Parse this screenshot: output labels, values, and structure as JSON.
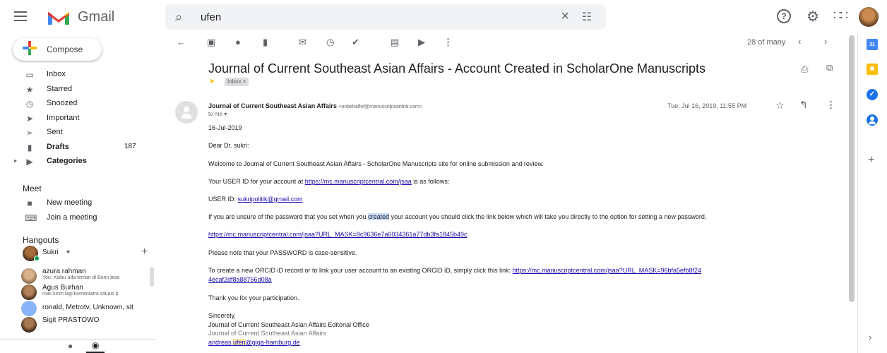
{
  "app": {
    "brand": "Gmail"
  },
  "search": {
    "query": "ufen"
  },
  "compose": {
    "label": "Compose"
  },
  "nav": {
    "items": [
      {
        "label": "Inbox",
        "icon": "inbox-icon",
        "glyph": "▭",
        "bold": false,
        "count": ""
      },
      {
        "label": "Starred",
        "icon": "star-icon",
        "glyph": "★",
        "bold": false,
        "count": ""
      },
      {
        "label": "Snoozed",
        "icon": "clock-icon",
        "glyph": "◷",
        "bold": false,
        "count": ""
      },
      {
        "label": "Important",
        "icon": "important-icon",
        "glyph": "➤",
        "bold": false,
        "count": ""
      },
      {
        "label": "Sent",
        "icon": "send-icon",
        "glyph": "➢",
        "bold": false,
        "count": ""
      },
      {
        "label": "Drafts",
        "icon": "draft-icon",
        "glyph": "▮",
        "bold": true,
        "count": "187"
      },
      {
        "label": "Categories",
        "icon": "label-icon",
        "glyph": "▶",
        "bold": true,
        "count": ""
      }
    ]
  },
  "meet": {
    "title": "Meet",
    "new_meeting": "New meeting",
    "join_meeting": "Join a meeting"
  },
  "hangouts": {
    "title": "Hangouts",
    "self_name": "Sukri",
    "contacts": [
      {
        "name": "azura rahman",
        "message": "You: Kalau ada teman di Bonn bisa"
      },
      {
        "name": "Agus Burhan",
        "message": "mas kirim lagi komentarta situasi p"
      },
      {
        "name": "ronald, Metrotv, Unknown, sit",
        "message": ""
      },
      {
        "name": "Sigit PRASTOWO",
        "message": ""
      }
    ]
  },
  "toolbar": {
    "pager": "28 of many"
  },
  "message": {
    "subject": "Journal of Current Southeast Asian Affairs - Account Created in ScholarOne Manuscripts",
    "label": "Inbox ×",
    "sender_name": "Journal of Current Southeast Asian Affairs",
    "sender_email": "<onbehalfof@manuscriptcentral.com>",
    "to": "to me ▾",
    "date": "Tue, Jul 16, 2019, 11:55 PM",
    "body": {
      "date_line": "16-Jul-2019",
      "greeting": "Dear Dr. sukri:",
      "welcome": "Welcome to Journal of Current Southeast Asian Affairs - ScholarOne Manuscripts site for online submission and review.",
      "userid_pre": "Your USER ID for your account at ",
      "userid_link": "https://mc.manuscriptcentral.com/jsaa",
      "userid_post": " is as follows:",
      "userid_label": "USER ID: ",
      "userid_value": "sukripolitik@gmail.com",
      "unsure_pre": "If you are unsure of the password that you set when you ",
      "unsure_hl": "created",
      "unsure_post": " your account you should click the link below which will take you directly to the option for setting a new password.",
      "reset_link": "https://mc.manuscriptcentral.com/jsaa?URL_MASK=9c9636e7a6034361a77db3fa1845b49c",
      "password_note": "Please note that your PASSWORD is case-sensitive.",
      "orcid_pre": "To create a new ORCID iD record or to link your user account to an existing ORCID iD, simply click this link: ",
      "orcid_link_1": "https://mc.manuscriptcentral.com/jsaa?URL_MASK=96bfa5efb8f24",
      "orcid_link_2": "4ecaf2df8a88766d08a",
      "thanks": "Thank you for your participation.",
      "sincerely": "Sincerely,",
      "office": "Journal of Current Southeast Asian Affairs Editorial Office",
      "journal": "Journal of Current Southeast Asian Affairs",
      "email_pre": "andreas.",
      "email_hl": "ufen",
      "email_post": "@giga-hamburg.de"
    }
  },
  "side_panel": {
    "calendar_day": "31"
  },
  "colors": {
    "accent_blue": "#1a73e8",
    "link": "#1a0dab",
    "important": "#f2c200",
    "search_bg": "#f1f3f4"
  }
}
